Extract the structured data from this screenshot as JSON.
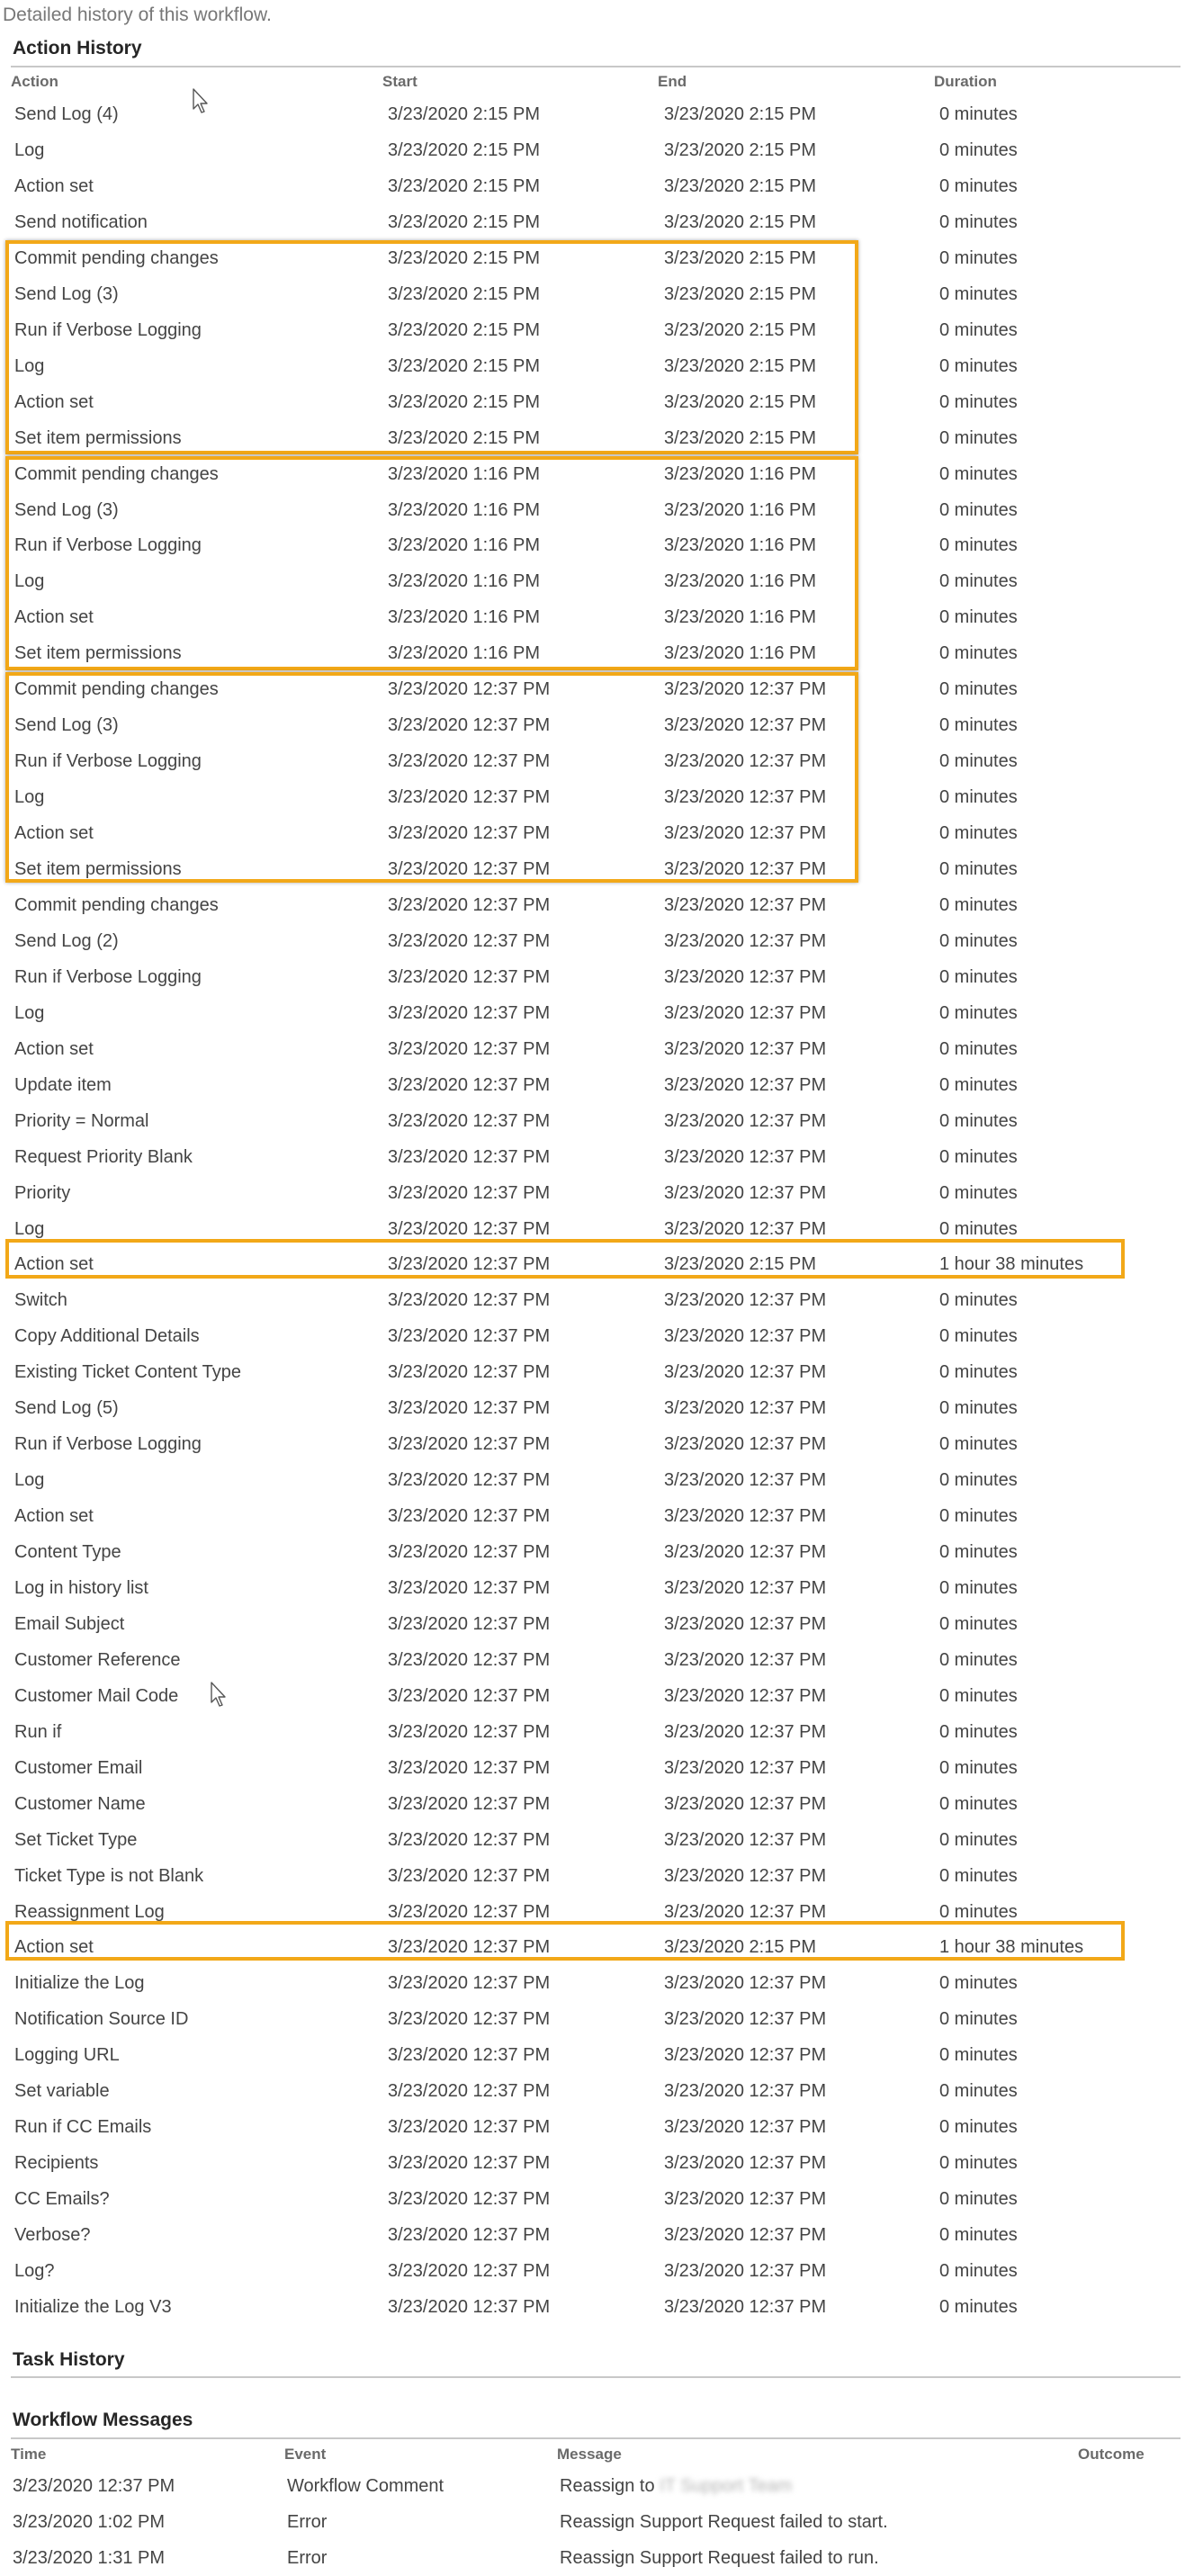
{
  "intro": "Detailed history of this workflow.",
  "action_history": {
    "title": "Action History",
    "columns": [
      "Action",
      "Start",
      "End",
      "Duration"
    ],
    "rows": [
      [
        "Send Log (4)",
        "3/23/2020 2:15 PM",
        "3/23/2020 2:15 PM",
        "0 minutes"
      ],
      [
        "Log",
        "3/23/2020 2:15 PM",
        "3/23/2020 2:15 PM",
        "0 minutes"
      ],
      [
        "Action set",
        "3/23/2020 2:15 PM",
        "3/23/2020 2:15 PM",
        "0 minutes"
      ],
      [
        "Send notification",
        "3/23/2020 2:15 PM",
        "3/23/2020 2:15 PM",
        "0 minutes"
      ],
      [
        "Commit pending changes",
        "3/23/2020 2:15 PM",
        "3/23/2020 2:15 PM",
        "0 minutes"
      ],
      [
        "Send Log (3)",
        "3/23/2020 2:15 PM",
        "3/23/2020 2:15 PM",
        "0 minutes"
      ],
      [
        "Run if Verbose Logging",
        "3/23/2020 2:15 PM",
        "3/23/2020 2:15 PM",
        "0 minutes"
      ],
      [
        "Log",
        "3/23/2020 2:15 PM",
        "3/23/2020 2:15 PM",
        "0 minutes"
      ],
      [
        "Action set",
        "3/23/2020 2:15 PM",
        "3/23/2020 2:15 PM",
        "0 minutes"
      ],
      [
        "Set item permissions",
        "3/23/2020 2:15 PM",
        "3/23/2020 2:15 PM",
        "0 minutes"
      ],
      [
        "Commit pending changes",
        "3/23/2020 1:16 PM",
        "3/23/2020 1:16 PM",
        "0 minutes"
      ],
      [
        "Send Log (3)",
        "3/23/2020 1:16 PM",
        "3/23/2020 1:16 PM",
        "0 minutes"
      ],
      [
        "Run if Verbose Logging",
        "3/23/2020 1:16 PM",
        "3/23/2020 1:16 PM",
        "0 minutes"
      ],
      [
        "Log",
        "3/23/2020 1:16 PM",
        "3/23/2020 1:16 PM",
        "0 minutes"
      ],
      [
        "Action set",
        "3/23/2020 1:16 PM",
        "3/23/2020 1:16 PM",
        "0 minutes"
      ],
      [
        "Set item permissions",
        "3/23/2020 1:16 PM",
        "3/23/2020 1:16 PM",
        "0 minutes"
      ],
      [
        "Commit pending changes",
        "3/23/2020 12:37 PM",
        "3/23/2020 12:37 PM",
        "0 minutes"
      ],
      [
        "Send Log (3)",
        "3/23/2020 12:37 PM",
        "3/23/2020 12:37 PM",
        "0 minutes"
      ],
      [
        "Run if Verbose Logging",
        "3/23/2020 12:37 PM",
        "3/23/2020 12:37 PM",
        "0 minutes"
      ],
      [
        "Log",
        "3/23/2020 12:37 PM",
        "3/23/2020 12:37 PM",
        "0 minutes"
      ],
      [
        "Action set",
        "3/23/2020 12:37 PM",
        "3/23/2020 12:37 PM",
        "0 minutes"
      ],
      [
        "Set item permissions",
        "3/23/2020 12:37 PM",
        "3/23/2020 12:37 PM",
        "0 minutes"
      ],
      [
        "Commit pending changes",
        "3/23/2020 12:37 PM",
        "3/23/2020 12:37 PM",
        "0 minutes"
      ],
      [
        "Send Log (2)",
        "3/23/2020 12:37 PM",
        "3/23/2020 12:37 PM",
        "0 minutes"
      ],
      [
        "Run if Verbose Logging",
        "3/23/2020 12:37 PM",
        "3/23/2020 12:37 PM",
        "0 minutes"
      ],
      [
        "Log",
        "3/23/2020 12:37 PM",
        "3/23/2020 12:37 PM",
        "0 minutes"
      ],
      [
        "Action set",
        "3/23/2020 12:37 PM",
        "3/23/2020 12:37 PM",
        "0 minutes"
      ],
      [
        "Update item",
        "3/23/2020 12:37 PM",
        "3/23/2020 12:37 PM",
        "0 minutes"
      ],
      [
        "Priority = Normal",
        "3/23/2020 12:37 PM",
        "3/23/2020 12:37 PM",
        "0 minutes"
      ],
      [
        "Request Priority Blank",
        "3/23/2020 12:37 PM",
        "3/23/2020 12:37 PM",
        "0 minutes"
      ],
      [
        "Priority",
        "3/23/2020 12:37 PM",
        "3/23/2020 12:37 PM",
        "0 minutes"
      ],
      [
        "Log",
        "3/23/2020 12:37 PM",
        "3/23/2020 12:37 PM",
        "0 minutes"
      ],
      [
        "Action set",
        "3/23/2020 12:37 PM",
        "3/23/2020 2:15 PM",
        "1 hour 38 minutes"
      ],
      [
        "Switch",
        "3/23/2020 12:37 PM",
        "3/23/2020 12:37 PM",
        "0 minutes"
      ],
      [
        "Copy Additional Details",
        "3/23/2020 12:37 PM",
        "3/23/2020 12:37 PM",
        "0 minutes"
      ],
      [
        "Existing Ticket Content Type",
        "3/23/2020 12:37 PM",
        "3/23/2020 12:37 PM",
        "0 minutes"
      ],
      [
        "Send Log (5)",
        "3/23/2020 12:37 PM",
        "3/23/2020 12:37 PM",
        "0 minutes"
      ],
      [
        "Run if Verbose Logging",
        "3/23/2020 12:37 PM",
        "3/23/2020 12:37 PM",
        "0 minutes"
      ],
      [
        "Log",
        "3/23/2020 12:37 PM",
        "3/23/2020 12:37 PM",
        "0 minutes"
      ],
      [
        "Action set",
        "3/23/2020 12:37 PM",
        "3/23/2020 12:37 PM",
        "0 minutes"
      ],
      [
        "Content Type",
        "3/23/2020 12:37 PM",
        "3/23/2020 12:37 PM",
        "0 minutes"
      ],
      [
        "Log in history list",
        "3/23/2020 12:37 PM",
        "3/23/2020 12:37 PM",
        "0 minutes"
      ],
      [
        "Email Subject",
        "3/23/2020 12:37 PM",
        "3/23/2020 12:37 PM",
        "0 minutes"
      ],
      [
        "Customer Reference",
        "3/23/2020 12:37 PM",
        "3/23/2020 12:37 PM",
        "0 minutes"
      ],
      [
        "Customer Mail Code",
        "3/23/2020 12:37 PM",
        "3/23/2020 12:37 PM",
        "0 minutes"
      ],
      [
        "Run if",
        "3/23/2020 12:37 PM",
        "3/23/2020 12:37 PM",
        "0 minutes"
      ],
      [
        "Customer Email",
        "3/23/2020 12:37 PM",
        "3/23/2020 12:37 PM",
        "0 minutes"
      ],
      [
        "Customer Name",
        "3/23/2020 12:37 PM",
        "3/23/2020 12:37 PM",
        "0 minutes"
      ],
      [
        "Set Ticket Type",
        "3/23/2020 12:37 PM",
        "3/23/2020 12:37 PM",
        "0 minutes"
      ],
      [
        "Ticket Type is not Blank",
        "3/23/2020 12:37 PM",
        "3/23/2020 12:37 PM",
        "0 minutes"
      ],
      [
        "Reassignment Log",
        "3/23/2020 12:37 PM",
        "3/23/2020 12:37 PM",
        "0 minutes"
      ],
      [
        "Action set",
        "3/23/2020 12:37 PM",
        "3/23/2020 2:15 PM",
        "1 hour 38 minutes"
      ],
      [
        "Initialize the Log",
        "3/23/2020 12:37 PM",
        "3/23/2020 12:37 PM",
        "0 minutes"
      ],
      [
        "Notification Source ID",
        "3/23/2020 12:37 PM",
        "3/23/2020 12:37 PM",
        "0 minutes"
      ],
      [
        "Logging URL",
        "3/23/2020 12:37 PM",
        "3/23/2020 12:37 PM",
        "0 minutes"
      ],
      [
        "Set variable",
        "3/23/2020 12:37 PM",
        "3/23/2020 12:37 PM",
        "0 minutes"
      ],
      [
        "Run if CC Emails",
        "3/23/2020 12:37 PM",
        "3/23/2020 12:37 PM",
        "0 minutes"
      ],
      [
        "Recipients",
        "3/23/2020 12:37 PM",
        "3/23/2020 12:37 PM",
        "0 minutes"
      ],
      [
        "CC Emails?",
        "3/23/2020 12:37 PM",
        "3/23/2020 12:37 PM",
        "0 minutes"
      ],
      [
        "Verbose?",
        "3/23/2020 12:37 PM",
        "3/23/2020 12:37 PM",
        "0 minutes"
      ],
      [
        "Log?",
        "3/23/2020 12:37 PM",
        "3/23/2020 12:37 PM",
        "0 minutes"
      ],
      [
        "Initialize the Log V3",
        "3/23/2020 12:37 PM",
        "3/23/2020 12:37 PM",
        "0 minutes"
      ]
    ]
  },
  "task_history": {
    "title": "Task History"
  },
  "workflow_messages": {
    "title": "Workflow Messages",
    "columns": [
      "Time",
      "Event",
      "Message",
      "Outcome"
    ],
    "rows": [
      {
        "time": "3/23/2020 12:37 PM",
        "event": "Workflow Comment",
        "message": "Reassign to",
        "redacted": "IT Support Team",
        "outcome": ""
      },
      {
        "time": "3/23/2020 1:02 PM",
        "event": "Error",
        "message": "Reassign Support Request failed to start.",
        "redacted": "",
        "outcome": ""
      },
      {
        "time": "3/23/2020 1:31 PM",
        "event": "Error",
        "message": "Reassign Support Request failed to run.",
        "redacted": "",
        "outcome": ""
      }
    ]
  },
  "highlight_color": "#F2A818",
  "icons": [
    "mouse-pointer-icon"
  ]
}
